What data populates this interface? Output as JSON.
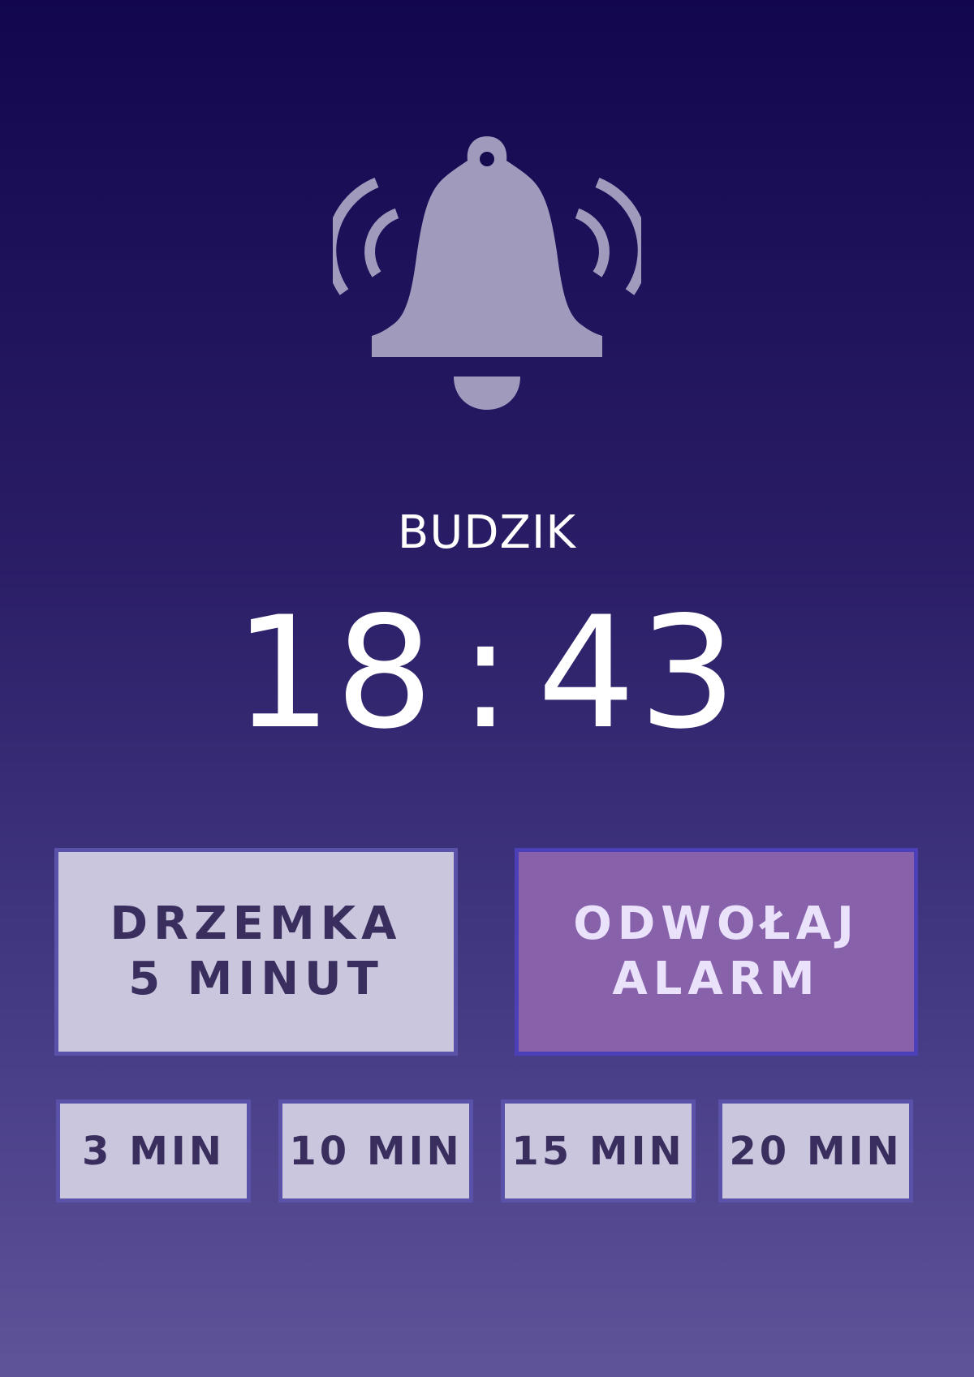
{
  "alarm": {
    "title": "BUDZIK",
    "hours": "18",
    "separator": ":",
    "minutes": "43"
  },
  "actions": {
    "snooze_label": "DRZEMKA\n5 MINUT",
    "dismiss_label": "ODWOŁAJ\nALARM"
  },
  "snooze_options": [
    "3 MIN",
    "10 MIN",
    "15 MIN",
    "20 MIN"
  ],
  "icons": {
    "main": "ringing-bell-icon"
  },
  "colors": {
    "background_top": "#12074e",
    "background_bottom": "#5f5399",
    "icon": "#a09bbd",
    "snooze_button": "#c9c6dd",
    "dismiss_button": "#8861ab",
    "button_border": "#5a52a8",
    "button_text_dark": "#3a2e5f",
    "button_text_light": "#eae2fb"
  }
}
